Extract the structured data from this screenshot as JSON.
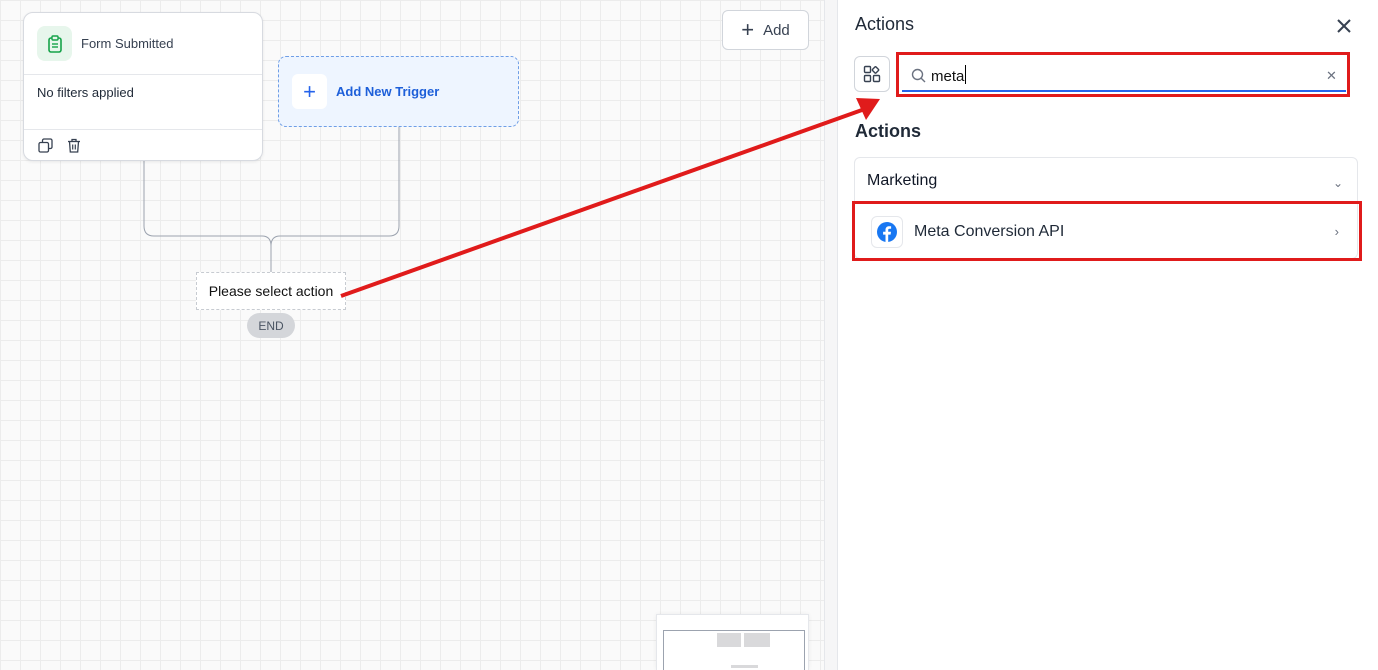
{
  "canvas": {
    "trigger_card": {
      "title": "Form Submitted",
      "filters_text": "No filters applied",
      "icon": "clipboard-icon"
    },
    "add_trigger": {
      "label": "Add New Trigger"
    },
    "add_button": {
      "label": "Add"
    },
    "action_placeholder": {
      "label": "Please select action"
    },
    "end_node": {
      "label": "END"
    }
  },
  "panel": {
    "title": "Actions",
    "search": {
      "value": "meta",
      "placeholder": ""
    },
    "section_title": "Actions",
    "categories": [
      {
        "label": "Marketing",
        "items": [
          {
            "label": "Meta Conversion API",
            "icon": "facebook-icon"
          }
        ]
      }
    ]
  },
  "colors": {
    "accent": "#2563eb",
    "highlight": "#e01b1b",
    "trigger_icon_bg": "#e7f6ec",
    "facebook": "#1877f2"
  }
}
